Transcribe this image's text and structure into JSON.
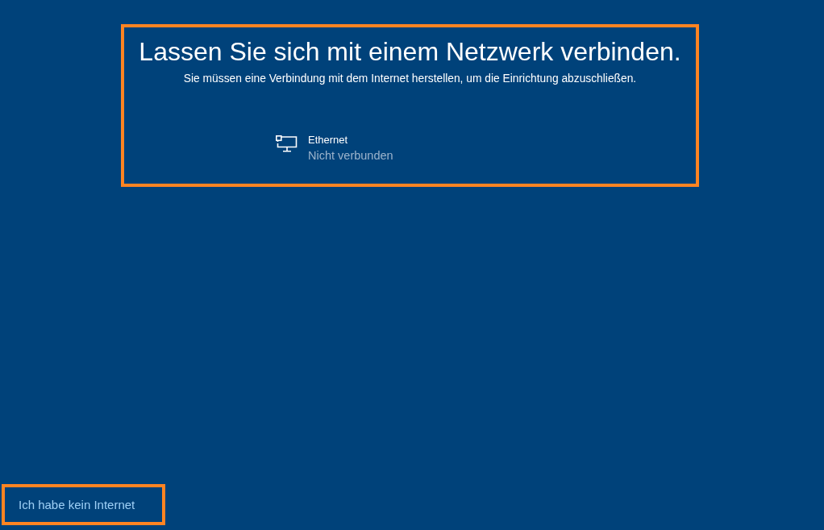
{
  "header": {
    "title": "Lassen Sie sich mit einem Netzwerk verbinden.",
    "subtitle": "Sie müssen eine Verbindung mit dem Internet herstellen, um die Einrichtung abzuschließen."
  },
  "networks": [
    {
      "name": "Ethernet",
      "status": "Nicht verbunden"
    }
  ],
  "offline_link": {
    "label": "Ich habe kein Internet"
  }
}
